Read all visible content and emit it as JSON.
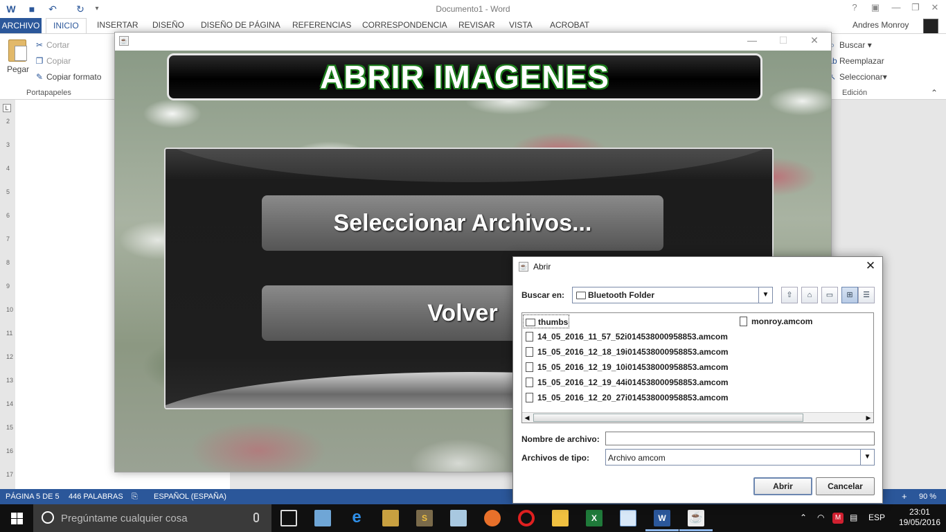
{
  "word": {
    "title": "Documento1 - Word",
    "tabs": [
      "ARCHIVO",
      "INICIO",
      "INSERTAR",
      "DISEÑO",
      "DISEÑO DE PÁGINA",
      "REFERENCIAS",
      "CORRESPONDENCIA",
      "REVISAR",
      "VISTA",
      "ACROBAT"
    ],
    "user": "Andres Monroy",
    "ribbon": {
      "paste": "Pegar",
      "cut": "Cortar",
      "copy": "Copiar",
      "format_painter": "Copiar formato",
      "clipboard_group": "Portapapeles",
      "find": "Buscar",
      "replace": "Reemplazar",
      "select": "Seleccionar",
      "editing_group": "Edición"
    },
    "ruler_numbers": [
      "2",
      "3",
      "4",
      "5",
      "6",
      "7",
      "8",
      "9",
      "10",
      "11",
      "12",
      "13",
      "14",
      "15",
      "16",
      "17"
    ],
    "status": {
      "page": "PÁGINA 5 DE 5",
      "words": "446 PALABRAS",
      "language": "ESPAÑOL (ESPAÑA)",
      "zoom": "90 %"
    }
  },
  "java_window": {
    "header": "ABRIR IMAGENES",
    "select_button": "Seleccionar Archivos...",
    "back_button": "Volver"
  },
  "dialog": {
    "title": "Abrir",
    "look_in_label": "Buscar en:",
    "look_in_value": "Bluetooth Folder",
    "files": [
      {
        "name": "thumbs",
        "type": "folder"
      },
      {
        "name": "14_05_2016_11_57_52i014538000958853.amcom",
        "type": "file"
      },
      {
        "name": "15_05_2016_12_18_19i014538000958853.amcom",
        "type": "file"
      },
      {
        "name": "15_05_2016_12_19_10i014538000958853.amcom",
        "type": "file"
      },
      {
        "name": "15_05_2016_12_19_44i014538000958853.amcom",
        "type": "file"
      },
      {
        "name": "15_05_2016_12_20_27i014538000958853.amcom",
        "type": "file"
      },
      {
        "name": "monroy.amcom",
        "type": "file"
      }
    ],
    "filename_label": "Nombre de archivo:",
    "filename_value": "",
    "filetype_label": "Archivos de tipo:",
    "filetype_value": "Archivo amcom",
    "open_button": "Abrir",
    "cancel_button": "Cancelar"
  },
  "taskbar": {
    "search_placeholder": "Pregúntame cualquier cosa",
    "language": "ESP",
    "time": "23:01",
    "date": "19/05/2016"
  }
}
